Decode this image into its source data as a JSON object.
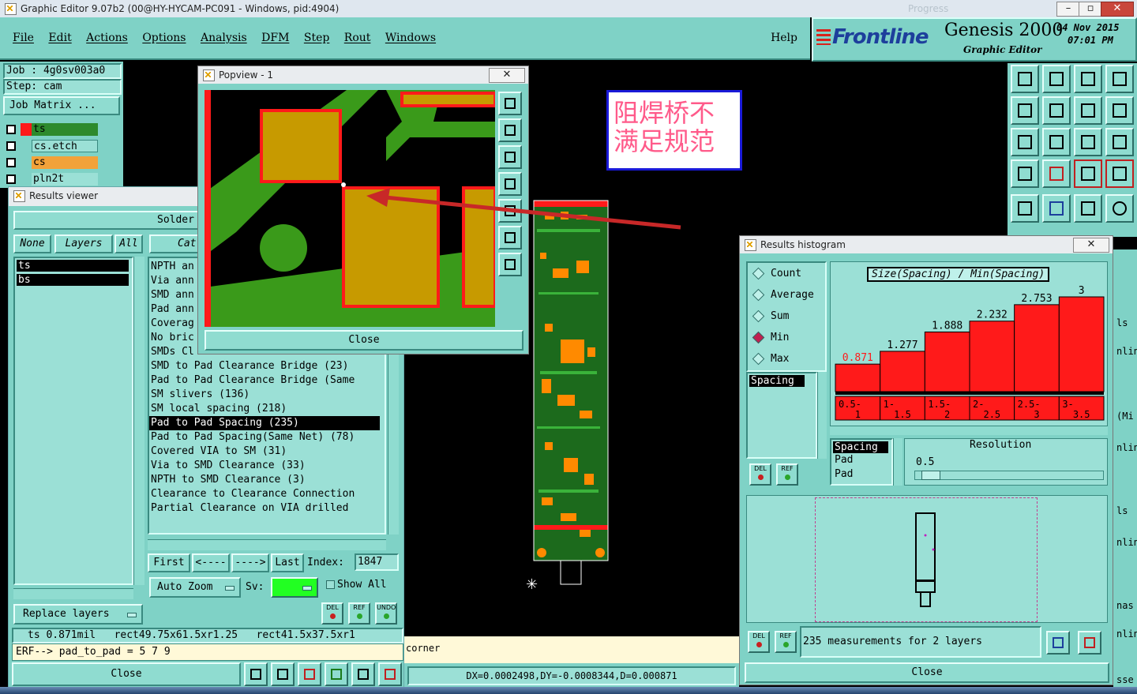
{
  "window": {
    "title": "Graphic Editor 9.07b2 (00@HY-HYCAM-PC091 - Windows, pid:4904)",
    "ghost_title": "Progress"
  },
  "menu": {
    "items": [
      "File",
      "Edit",
      "Actions",
      "Options",
      "Analysis",
      "DFM",
      "Step",
      "Rout",
      "Windows"
    ],
    "help": "Help"
  },
  "brand": {
    "logo": "Frontline",
    "product": "Genesis 2000",
    "subtitle": "Graphic Editor",
    "date": "04 Nov 2015",
    "time": "07:01 PM"
  },
  "job": {
    "job_line": "Job : 4g0sv003a0",
    "step_line": "Step: cam",
    "matrix_button": "Job Matrix ..."
  },
  "layers": [
    {
      "name": "ts",
      "color": "#2d8a2d"
    },
    {
      "name": "cs.etch",
      "color": "#9be0d6"
    },
    {
      "name": "cs",
      "color": "#f2a23a"
    },
    {
      "name": "pln2t",
      "color": "#9be0d6"
    }
  ],
  "results_viewer": {
    "title": "Results viewer",
    "header": "Solder M",
    "tabs": {
      "none": "None",
      "layers": "Layers",
      "all": "All",
      "category": "Cat"
    },
    "layer_list": [
      "ts",
      "bs"
    ],
    "categories": [
      "NPTH an",
      "Via ann",
      "SMD ann",
      "Pad ann",
      "Coverag",
      "No bric",
      "SMDs Cl",
      "SMD to Pad Clearance Bridge (23)",
      "Pad to Pad Clearance Bridge (Same",
      "SM slivers (136)",
      "SM local spacing (218)",
      "Pad to Pad Spacing (235)",
      "Pad to Pad Spacing(Same Net) (78)",
      "Covered VIA to SM (31)",
      "Via to SMD Clearance (33)",
      "NPTH to SMD Clearance (3)",
      "Clearance to Clearance Connection",
      "Partial Clearance on VIA drilled"
    ],
    "selected_index": 11,
    "nav": {
      "first": "First",
      "prev": "<----",
      "next": "---->",
      "last": "Last",
      "index_label": "Index:",
      "index_value": "1847"
    },
    "zoom": "Auto Zoom",
    "sv_label": "Sv:",
    "show_all": "Show All",
    "replace_layers": "Replace layers",
    "info_line": "ts 0.871mil   rect49.75x61.5xr1.25   rect41.5x37.5xr1",
    "erf_line": "ERF--> pad_to_pad = 5 7 9",
    "close": "Close",
    "tool_del": "DEL",
    "tool_ref": "REF",
    "tool_undo": "UNDO"
  },
  "popview": {
    "title": "Popview - 1",
    "close": "Close"
  },
  "annotation": {
    "line1": "阻焊桥不",
    "line2": "满足规范"
  },
  "statusbar": {
    "corner": "corner",
    "coords": "DX=0.0002498,DY=-0.0008344,D=0.000871"
  },
  "histogram": {
    "title": "Results histogram",
    "modes": [
      "Count",
      "Average",
      "Sum",
      "Min",
      "Max"
    ],
    "selected_mode": "Min",
    "header": "Size(Spacing) / Min(Spacing)",
    "list_item": "Spacing",
    "legend": [
      "Spacing",
      "Pad",
      "Pad"
    ],
    "resolution_label": "Resolution",
    "resolution_value": "0.5",
    "measurements": "235 measurements for 2 layers",
    "close": "Close",
    "del": "DEL",
    "ref": "REF",
    "bar_color": "#ff1a1a",
    "chart_data": {
      "type": "bar",
      "categories": [
        "0.5-\n1",
        "1-\n1.5",
        "1.5-\n2",
        "2-\n2.5",
        "2.5-\n3",
        "3-\n3.5"
      ],
      "values": [
        0.871,
        1.277,
        1.888,
        2.232,
        2.753,
        3
      ],
      "value_labels": [
        "0.871",
        "1.277",
        "1.888",
        "2.232",
        "2.753",
        "3"
      ],
      "ylim": [
        0,
        3.2
      ]
    }
  },
  "right_edge": [
    "ls",
    "nlin",
    "(Mi",
    "nlin",
    "ls",
    "nlin",
    "nas",
    "nlin",
    "sse"
  ]
}
